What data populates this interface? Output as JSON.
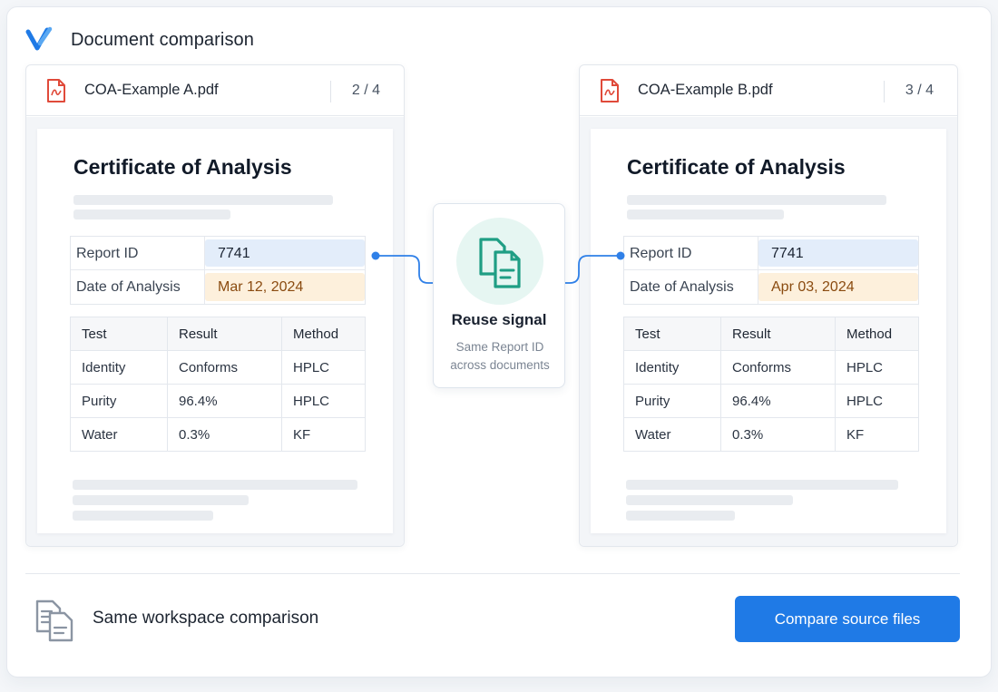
{
  "app": {
    "title": "Document comparison",
    "logo_icon": "v-check-logo"
  },
  "documents": [
    {
      "file_name": "COA-Example A.pdf",
      "page_indicator": "2 / 4",
      "heading": "Certificate of Analysis",
      "report_id_label": "Report ID",
      "report_id_value": "7741",
      "date_label": "Date of Analysis",
      "date_value": "Mar 12, 2024",
      "table": {
        "headers": [
          "Test",
          "Result",
          "Method"
        ],
        "rows": [
          [
            "Identity",
            "Conforms",
            "HPLC"
          ],
          [
            "Purity",
            "96.4%",
            "HPLC"
          ],
          [
            "Water",
            "0.3%",
            "KF"
          ]
        ]
      }
    },
    {
      "file_name": "COA-Example B.pdf",
      "page_indicator": "3 / 4",
      "heading": "Certificate of Analysis",
      "report_id_label": "Report ID",
      "report_id_value": "7741",
      "date_label": "Date of Analysis",
      "date_value": "Apr 03, 2024",
      "table": {
        "headers": [
          "Test",
          "Result",
          "Method"
        ],
        "rows": [
          [
            "Identity",
            "Conforms",
            "HPLC"
          ],
          [
            "Purity",
            "96.4%",
            "HPLC"
          ],
          [
            "Water",
            "0.3%",
            "KF"
          ]
        ]
      }
    }
  ],
  "signal": {
    "title": "Reuse signal",
    "subtitle": "Same Report ID across documents",
    "icon": "duplicate-documents-icon"
  },
  "footer": {
    "label": "Same workspace comparison",
    "button_label": "Compare source files",
    "icon": "documents-icon"
  },
  "colors": {
    "accent": "#1f7ae6",
    "id_highlight": "#e3edfa",
    "date_highlight": "#fdf0dc",
    "date_text": "#8a4b10",
    "signal_green": "#1f9e84",
    "pdf_red": "#e04a3a"
  }
}
